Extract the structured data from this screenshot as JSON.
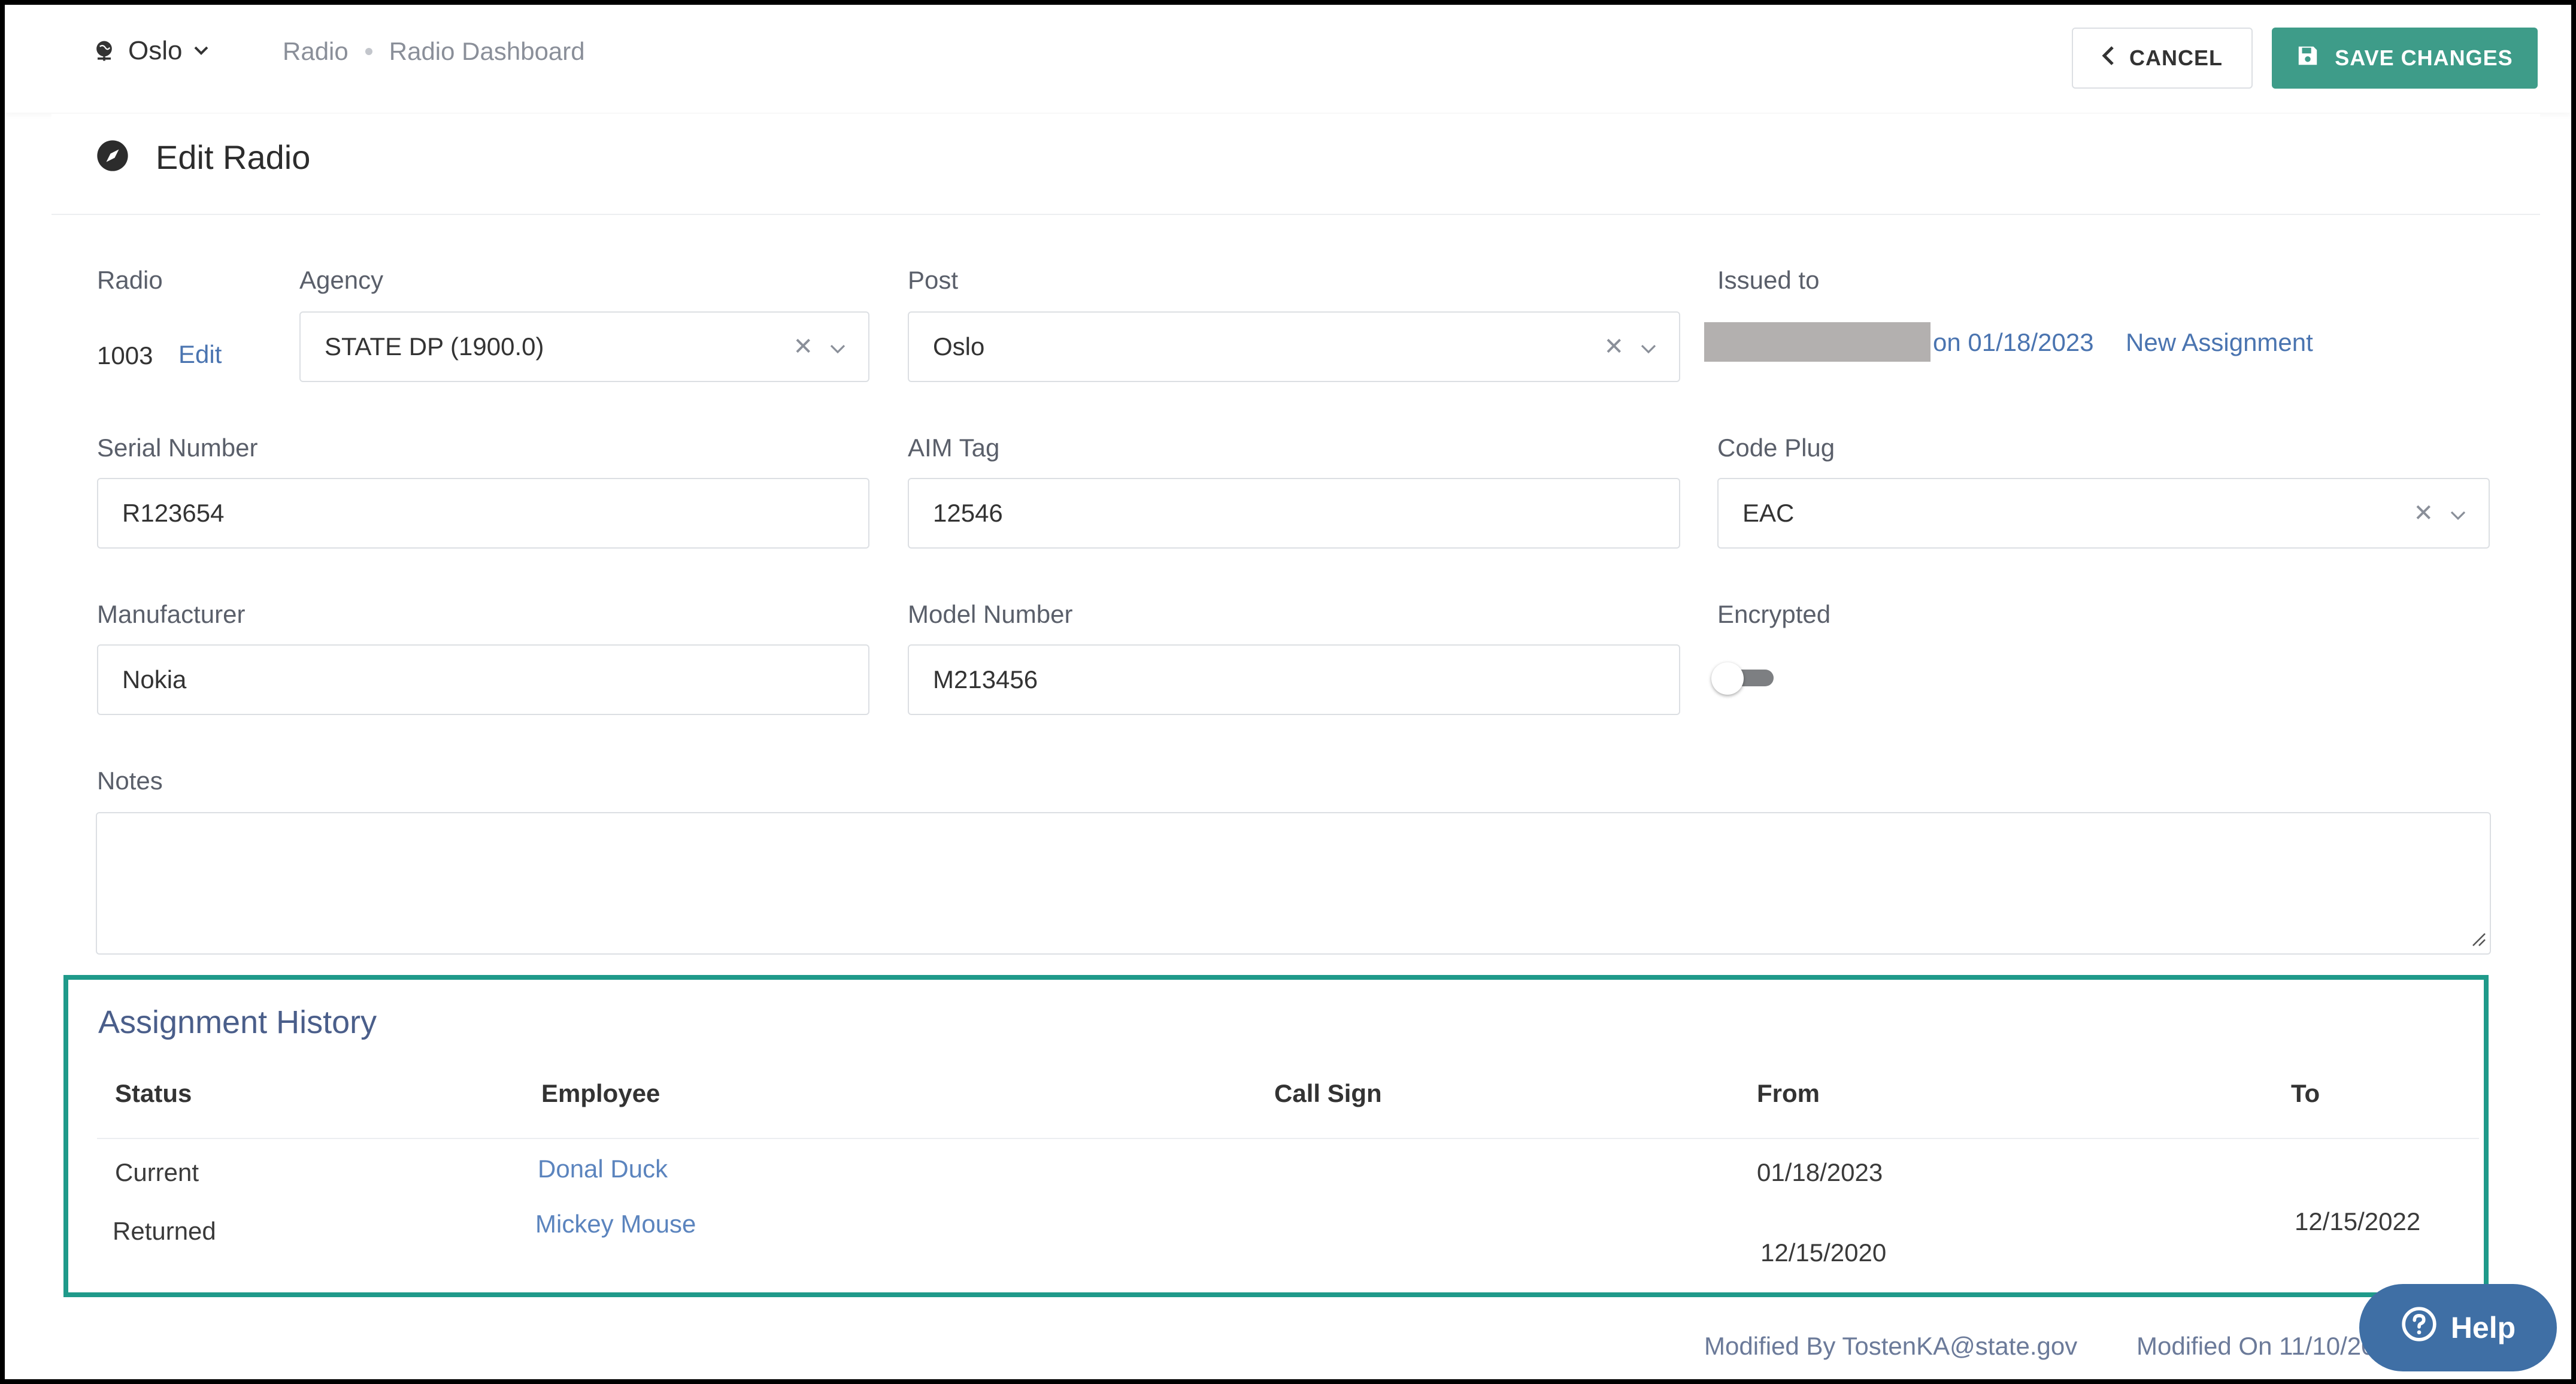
{
  "header": {
    "location": "Oslo",
    "breadcrumb": [
      "Radio",
      "Radio Dashboard"
    ],
    "cancel_label": "CANCEL",
    "save_label": "SAVE CHANGES"
  },
  "page": {
    "title": "Edit Radio"
  },
  "form": {
    "radio_label": "Radio",
    "radio_value": "1003",
    "radio_edit": "Edit",
    "agency_label": "Agency",
    "agency_value": "STATE DP (1900.0)",
    "post_label": "Post",
    "post_value": "Oslo",
    "issued_label": "Issued to",
    "issued_date": "on 01/18/2023",
    "new_assignment": "New Assignment",
    "serial_label": "Serial Number",
    "serial_value": "R123654",
    "aim_label": "AIM Tag",
    "aim_value": "12546",
    "codeplug_label": "Code Plug",
    "codeplug_value": "EAC",
    "manufacturer_label": "Manufacturer",
    "manufacturer_value": "Nokia",
    "model_label": "Model Number",
    "model_value": "M213456",
    "encrypted_label": "Encrypted",
    "encrypted_on": false,
    "notes_label": "Notes",
    "notes_value": ""
  },
  "history": {
    "title": "Assignment History",
    "columns": [
      "Status",
      "Employee",
      "Call Sign",
      "From",
      "To"
    ],
    "rows": [
      {
        "status": "Current",
        "employee": "Donal Duck",
        "call_sign": "",
        "from": "01/18/2023",
        "to": ""
      },
      {
        "status": "Returned",
        "employee": "Mickey Mouse",
        "call_sign": "",
        "from": "12/15/2020",
        "to": "12/15/2022"
      }
    ]
  },
  "footer": {
    "modified_by_label": "Modified By",
    "modified_by": "TostenKA@state.gov",
    "modified_on_label": "Modified On",
    "modified_on": "11/10/20"
  },
  "help_label": "Help",
  "colors": {
    "accent": "#3e9c89",
    "highlight": "#1f9a8a",
    "link": "#4a74b0",
    "help": "#3f6fa5"
  }
}
